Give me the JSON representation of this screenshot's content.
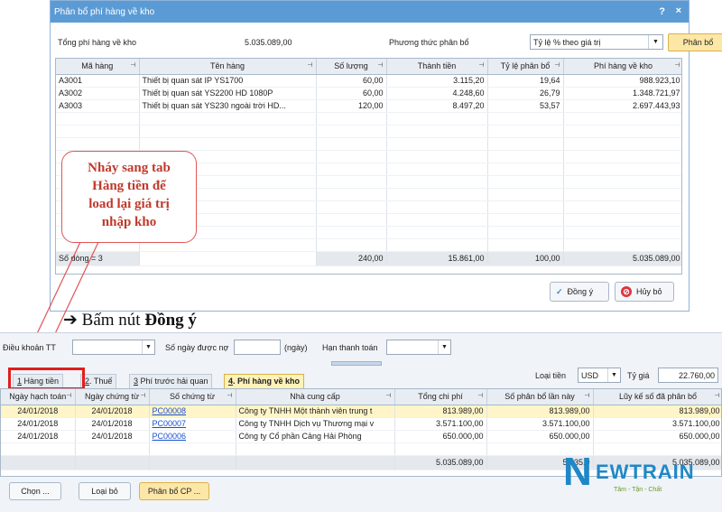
{
  "dialog": {
    "title": "Phân bổ phí hàng về kho",
    "help": "?",
    "close": "×",
    "total_label": "Tổng phí hàng về kho",
    "total_value": "5.035.089,00",
    "method_label": "Phương thức phân bổ",
    "method_value": "Tỷ lệ % theo giá trị",
    "allocate_label": "Phân bổ",
    "columns": [
      "Mã hàng",
      "Tên hàng",
      "Số lượng",
      "Thành tiền",
      "Tỷ lệ phân bổ",
      "Phí hàng về kho"
    ],
    "rows": [
      [
        "A3001",
        "Thiết bị quan sát IP YS1700",
        "60,00",
        "3.115,20",
        "19,64",
        "988.923,10"
      ],
      [
        "A3002",
        "Thiết bị quan sát YS2200 HD 1080P",
        "60,00",
        "4.248,60",
        "26,79",
        "1.348.721,97"
      ],
      [
        "A3003",
        "Thiết bị quan sát YS230 ngoài trời HD...",
        "120,00",
        "8.497,20",
        "53,57",
        "2.697.443,93"
      ]
    ],
    "footer": [
      "Số dòng = 3",
      "",
      "240,00",
      "15.861,00",
      "100,00",
      "5.035.089,00"
    ],
    "ok_label": "Đồng ý",
    "cancel_label": "Hủy bỏ"
  },
  "callout": {
    "lines": [
      "Nháy sang tab",
      "Hàng tiền để",
      "load lại giá trị",
      "nhập kho"
    ]
  },
  "instruction": {
    "arrow": "➔",
    "prefix": "Bấm nút",
    "bold": "Đồng ý"
  },
  "bottom": {
    "terms_label": "Điều khoản TT",
    "days_label": "Số ngày được nợ",
    "days_unit": "(ngày)",
    "due_label": "Hạn thanh toán",
    "tabs": [
      {
        "key": "1",
        "label": " Hàng tiền"
      },
      {
        "key": "2",
        "label": ". Thuế"
      },
      {
        "key": "3",
        "label": " Phí trước hải quan"
      },
      {
        "key": "4",
        "label": ". Phí hàng về kho"
      }
    ],
    "currency_label": "Loại tiền",
    "currency_value": "USD",
    "rate_label": "Tỷ giá",
    "rate_value": "22.760,00",
    "columns": [
      "Ngày hạch toán",
      "Ngày chứng từ",
      "Số chứng từ",
      "Nhà cung cấp",
      "Tổng chi phí",
      "Số phân bổ lần này",
      "Lũy kế số đã phân bổ"
    ],
    "rows": [
      [
        "24/01/2018",
        "24/01/2018",
        "PC00008",
        "Công ty TNHH Một thành viên trung t",
        "813.989,00",
        "813.989,00",
        "813.989,00"
      ],
      [
        "24/01/2018",
        "24/01/2018",
        "PC00007",
        "Công ty TNHH Dịch vụ Thương mại v",
        "3.571.100,00",
        "3.571.100,00",
        "3.571.100,00"
      ],
      [
        "24/01/2018",
        "24/01/2018",
        "PC00006",
        "Công ty Cổ phần Cảng Hải Phòng",
        "650.000,00",
        "650.000,00",
        "650.000,00"
      ]
    ],
    "footer": [
      "",
      "",
      "",
      "",
      "5.035.089,00",
      "5.035.0",
      "5.035.089,00"
    ],
    "btn_choose": "Chọn ...",
    "btn_remove": "Loại bỏ",
    "btn_alloc": "Phân bổ CP ..."
  },
  "logo": {
    "letter": "N",
    "text": "EWTRAIN",
    "tagline": "Tâm - Tận - Chất"
  }
}
